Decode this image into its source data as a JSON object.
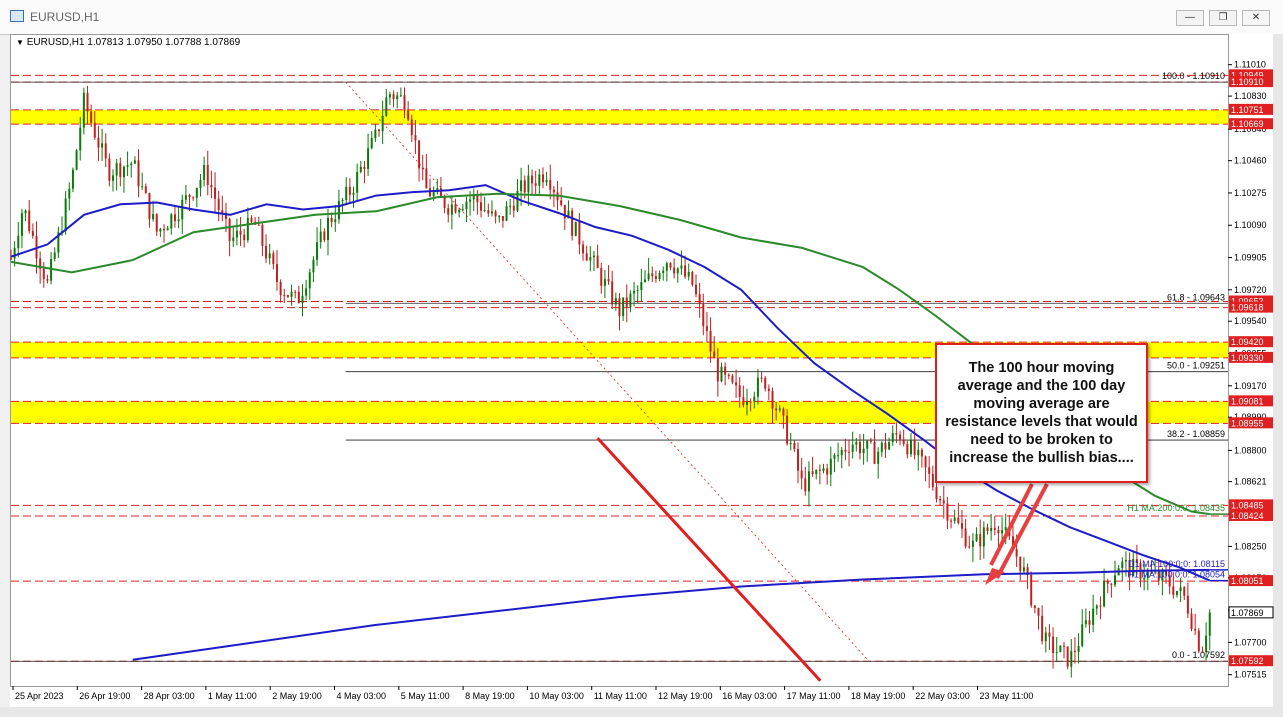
{
  "window": {
    "title": "EURUSD,H1",
    "symbol_header": "EURUSD,H1  1.07813 1.07950 1.07788 1.07869",
    "buttons": [
      "minimize",
      "restore",
      "close"
    ]
  },
  "annotation": {
    "text": "The 100  hour moving average and the 100 day moving average are resistance levels that would need to be broken to increase the bullish bias...."
  },
  "chart_data": {
    "type": "candlestick",
    "title": "EURUSD,H1",
    "ohlc_last": {
      "open": 1.07813,
      "high": 1.0795,
      "low": 1.07788,
      "close": 1.07869
    },
    "ylim": [
      1.0745,
      1.1118
    ],
    "y_ticks": [
      "1.11010",
      "1.10830",
      "1.10640",
      "1.10460",
      "1.10275",
      "1.10090",
      "1.09905",
      "1.09720",
      "1.09540",
      "1.09355",
      "1.09170",
      "1.08990",
      "1.08800",
      "1.08621",
      "1.08435",
      "1.08250",
      "1.08070",
      "1.07885",
      "1.07700",
      "1.07515"
    ],
    "x_ticks": [
      "25 Apr 2023",
      "26 Apr 19:00",
      "28 Apr 03:00",
      "1 May 11:00",
      "2 May 19:00",
      "4 May 03:00",
      "5 May 11:00",
      "8 May 19:00",
      "10 May 03:00",
      "11 May 11:00",
      "12 May 19:00",
      "16 May 03:00",
      "17 May 11:00",
      "18 May 19:00",
      "22 May 03:00",
      "23 May 11:00"
    ],
    "price_boxes": [
      {
        "label": "1.10949",
        "value": 1.10949,
        "color": "#e02020"
      },
      {
        "label": "1.10910",
        "value": 1.1091,
        "color": "#e02020"
      },
      {
        "label": "1.10751",
        "value": 1.10751,
        "color": "#e02020"
      },
      {
        "label": "1.10669",
        "value": 1.10669,
        "color": "#e02020"
      },
      {
        "label": "1.09653",
        "value": 1.09653,
        "color": "#e02020"
      },
      {
        "label": "1.09618",
        "value": 1.09618,
        "color": "#e02020"
      },
      {
        "label": "1.09420",
        "value": 1.0942,
        "color": "#e02020"
      },
      {
        "label": "1.09330",
        "value": 1.0933,
        "color": "#e02020"
      },
      {
        "label": "1.09081",
        "value": 1.09081,
        "color": "#e02020"
      },
      {
        "label": "1.08955",
        "value": 1.08955,
        "color": "#e02020"
      },
      {
        "label": "1.08485",
        "value": 1.08485,
        "color": "#e02020"
      },
      {
        "label": "1.08424",
        "value": 1.08424,
        "color": "#e02020"
      },
      {
        "label": "1.08051",
        "value": 1.08051,
        "color": "#e02020"
      },
      {
        "label": "1.07869",
        "value": 1.07869,
        "color": "#000000"
      },
      {
        "label": "1.07592",
        "value": 1.07592,
        "color": "#e02020"
      }
    ],
    "resistance_zones": [
      {
        "low": 1.10669,
        "high": 1.10751
      },
      {
        "low": 1.0933,
        "high": 1.0942
      },
      {
        "low": 1.08955,
        "high": 1.09081
      }
    ],
    "fib_levels": [
      {
        "label": "100.0 - 1.10910",
        "value": 1.1091
      },
      {
        "label": "61.8 - 1.09643",
        "value": 1.09643
      },
      {
        "label": "50.0 - 1.09251",
        "value": 1.09251
      },
      {
        "label": "38.2 - 1.08859",
        "value": 1.08859
      },
      {
        "label": "0.0 - 1.07592",
        "value": 1.07592
      }
    ],
    "ma_labels": [
      {
        "label": "H1 MA:200:0:0: 1.08435",
        "value": 1.08435,
        "color": "#2a8a2a"
      },
      {
        "label": "D1 MA:100:0:0: 1.08115",
        "value": 1.08115,
        "color": "#2020c0"
      },
      {
        "label": "H1 MA:100:0:0: 1.08054",
        "value": 1.08054,
        "color": "#2020c0"
      }
    ],
    "series": [
      {
        "name": "H1 MA:100",
        "color": "#1c1cc8",
        "x": [
          0,
          0.03,
          0.06,
          0.09,
          0.12,
          0.15,
          0.18,
          0.21,
          0.24,
          0.27,
          0.3,
          0.33,
          0.36,
          0.39,
          0.42,
          0.45,
          0.48,
          0.51,
          0.54,
          0.57,
          0.6,
          0.63,
          0.66,
          0.69,
          0.72,
          0.75,
          0.78,
          0.81,
          0.84,
          0.87,
          0.9,
          0.93,
          0.96,
          0.985
        ],
        "values": [
          1.0991,
          1.0998,
          1.1015,
          1.1021,
          1.1022,
          1.1018,
          1.1015,
          1.1021,
          1.1018,
          1.102,
          1.1026,
          1.1028,
          1.1029,
          1.1032,
          1.1023,
          1.1016,
          1.1008,
          1.1003,
          1.0995,
          1.0985,
          1.0972,
          1.095,
          1.093,
          1.0915,
          1.0901,
          1.0886,
          1.087,
          1.0857,
          1.0846,
          1.0836,
          1.0828,
          1.082,
          1.0813,
          1.08054
        ]
      },
      {
        "name": "H1 MA:200",
        "color": "#2a8a2a",
        "x": [
          0,
          0.05,
          0.1,
          0.15,
          0.2,
          0.25,
          0.3,
          0.35,
          0.4,
          0.45,
          0.5,
          0.55,
          0.6,
          0.65,
          0.7,
          0.73,
          0.76,
          0.79,
          0.82,
          0.85,
          0.88,
          0.91,
          0.94,
          0.97,
          0.985
        ],
        "values": [
          1.0988,
          1.0982,
          1.0989,
          1.1005,
          1.101,
          1.1015,
          1.1017,
          1.1025,
          1.1027,
          1.1026,
          1.102,
          1.1012,
          1.1002,
          1.0996,
          1.0985,
          1.0972,
          1.0957,
          1.0941,
          1.0923,
          1.0903,
          1.0884,
          1.0867,
          1.0854,
          1.0845,
          1.08435
        ]
      },
      {
        "name": "D1 MA:100",
        "color": "#1c1cc8",
        "x": [
          0.1,
          0.2,
          0.3,
          0.4,
          0.5,
          0.6,
          0.7,
          0.8,
          0.88,
          0.93,
          0.985
        ],
        "values": [
          1.076,
          1.077,
          1.078,
          1.0788,
          1.0796,
          1.0802,
          1.0806,
          1.0809,
          1.081,
          1.0811,
          1.08115
        ]
      }
    ],
    "grid": false,
    "legend": "none"
  }
}
